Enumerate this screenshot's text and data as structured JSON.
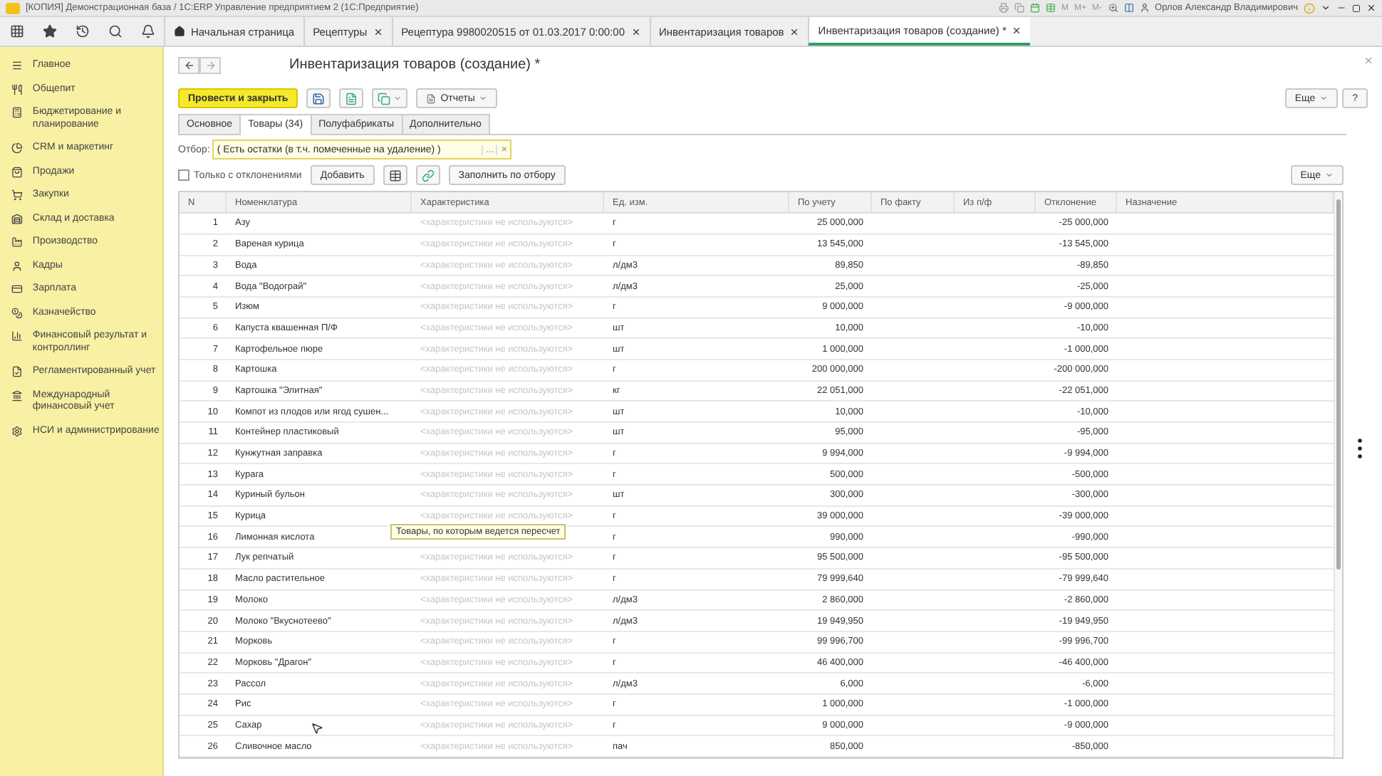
{
  "window": {
    "title": "[КОПИЯ] Демонстрационная база / 1С:ERP Управление предприятием 2  (1С:Предприятие)",
    "memory_buttons": [
      "M",
      "M+",
      "M-"
    ],
    "user": "Орлов Александр Владимирович"
  },
  "open_tabs": [
    {
      "label": "Начальная страница",
      "kind": "home",
      "selected": false
    },
    {
      "label": "Рецептуры",
      "kind": "closable",
      "selected": false
    },
    {
      "label": "Рецептура 9980020515 от 01.03.2017 0:00:00",
      "kind": "closable",
      "selected": false
    },
    {
      "label": "Инвентаризация товаров",
      "kind": "closable",
      "selected": false
    },
    {
      "label": "Инвентаризация товаров (создание) *",
      "kind": "closable",
      "selected": true
    }
  ],
  "sidebar": {
    "items": [
      {
        "label": "Главное"
      },
      {
        "label": "Общепит"
      },
      {
        "label": "Бюджетирование и планирование"
      },
      {
        "label": "CRM и маркетинг"
      },
      {
        "label": "Продажи"
      },
      {
        "label": "Закупки"
      },
      {
        "label": "Склад и доставка"
      },
      {
        "label": "Производство"
      },
      {
        "label": "Кадры"
      },
      {
        "label": "Зарплата"
      },
      {
        "label": "Казначейство"
      },
      {
        "label": "Финансовый результат и контроллинг"
      },
      {
        "label": "Регламентированный учет"
      },
      {
        "label": "Международный финансовый учет"
      },
      {
        "label": "НСИ и администрирование"
      }
    ]
  },
  "form": {
    "title": "Инвентаризация товаров (создание) *",
    "post_button": "Провести и закрыть",
    "reports_button": "Отчеты",
    "more_button": "Еще",
    "help_button": "?",
    "tabs": [
      {
        "label": "Основное",
        "selected": false
      },
      {
        "label": "Товары (34)",
        "selected": true
      },
      {
        "label": "Полуфабрикаты",
        "selected": false
      },
      {
        "label": "Дополнительно",
        "selected": false
      }
    ],
    "filter": {
      "label": "Отбор:",
      "value": "( Есть остатки (в т.ч. помеченные на удаление) )",
      "choose": "...",
      "clear": "×"
    },
    "only_deviations": {
      "label": "Только с отклонениями",
      "checked": false
    },
    "add_button": "Добавить",
    "fill_button": "Заполнить по отбору",
    "table_more_button": "Еще"
  },
  "table": {
    "columns": [
      "N",
      "Номенклатура",
      "Характеристика",
      "Ед. изм.",
      "По учету",
      "По факту",
      "Из п/ф",
      "Отклонение",
      "Назначение"
    ],
    "tooltip": "Товары, по которым ведется пересчет",
    "rows": [
      {
        "n": "1",
        "name": "Азу",
        "characteristic": "<характеристики не используются>",
        "unit": "г",
        "account": "25 000,000",
        "deviation": "-25 000,000"
      },
      {
        "n": "2",
        "name": "Вареная курица",
        "characteristic": "<характеристики не используются>",
        "unit": "г",
        "account": "13 545,000",
        "deviation": "-13 545,000"
      },
      {
        "n": "3",
        "name": "Вода",
        "characteristic": "<характеристики не используются>",
        "unit": "л/дм3",
        "account": "89,850",
        "deviation": "-89,850"
      },
      {
        "n": "4",
        "name": "Вода \"Водограй\"",
        "characteristic": "<характеристики не используются>",
        "unit": "л/дм3",
        "account": "25,000",
        "deviation": "-25,000"
      },
      {
        "n": "5",
        "name": "Изюм",
        "characteristic": "<характеристики не используются>",
        "unit": "г",
        "account": "9 000,000",
        "deviation": "-9 000,000"
      },
      {
        "n": "6",
        "name": "Капуста квашенная П/Ф",
        "characteristic": "<характеристики не используются>",
        "unit": "шт",
        "account": "10,000",
        "deviation": "-10,000"
      },
      {
        "n": "7",
        "name": "Картофельное пюре",
        "characteristic": "<характеристики не используются>",
        "unit": "шт",
        "account": "1 000,000",
        "deviation": "-1 000,000"
      },
      {
        "n": "8",
        "name": "Картошка",
        "characteristic": "<характеристики не используются>",
        "unit": "г",
        "account": "200 000,000",
        "deviation": "-200 000,000"
      },
      {
        "n": "9",
        "name": "Картошка \"Элитная\"",
        "characteristic": "<характеристики не используются>",
        "unit": "кг",
        "account": "22 051,000",
        "deviation": "-22 051,000"
      },
      {
        "n": "10",
        "name": "Компот из плодов или ягод сушен...",
        "characteristic": "<характеристики не используются>",
        "unit": "шт",
        "account": "10,000",
        "deviation": "-10,000"
      },
      {
        "n": "11",
        "name": "Контейнер пластиковый",
        "characteristic": "<характеристики не используются>",
        "unit": "шт",
        "account": "95,000",
        "deviation": "-95,000"
      },
      {
        "n": "12",
        "name": "Кунжутная заправка",
        "characteristic": "<характеристики не используются>",
        "unit": "г",
        "account": "9 994,000",
        "deviation": "-9 994,000"
      },
      {
        "n": "13",
        "name": "Курага",
        "characteristic": "<характеристики не используются>",
        "unit": "г",
        "account": "500,000",
        "deviation": "-500,000"
      },
      {
        "n": "14",
        "name": "Куриный бульон",
        "characteristic": "<характеристики не используются>",
        "unit": "шт",
        "account": "300,000",
        "deviation": "-300,000"
      },
      {
        "n": "15",
        "name": "Курица",
        "characteristic": "<характеристики не используются>",
        "unit": "г",
        "account": "39 000,000",
        "deviation": "-39 000,000"
      },
      {
        "n": "16",
        "name": "Лимонная кислота",
        "characteristic": "",
        "unit": "г",
        "account": "990,000",
        "deviation": "-990,000"
      },
      {
        "n": "17",
        "name": "Лук репчатый",
        "characteristic": "<характеристики не используются>",
        "unit": "г",
        "account": "95 500,000",
        "deviation": "-95 500,000"
      },
      {
        "n": "18",
        "name": "Масло растительное",
        "characteristic": "<характеристики не используются>",
        "unit": "г",
        "account": "79 999,640",
        "deviation": "-79 999,640"
      },
      {
        "n": "19",
        "name": "Молоко",
        "characteristic": "<характеристики не используются>",
        "unit": "л/дм3",
        "account": "2 860,000",
        "deviation": "-2 860,000"
      },
      {
        "n": "20",
        "name": "Молоко \"Вкуснотеево\"",
        "characteristic": "<характеристики не используются>",
        "unit": "л/дм3",
        "account": "19 949,950",
        "deviation": "-19 949,950"
      },
      {
        "n": "21",
        "name": "Морковь",
        "characteristic": "<характеристики не используются>",
        "unit": "г",
        "account": "99 996,700",
        "deviation": "-99 996,700"
      },
      {
        "n": "22",
        "name": "Морковь \"Драгон\"",
        "characteristic": "<характеристики не используются>",
        "unit": "г",
        "account": "46 400,000",
        "deviation": "-46 400,000"
      },
      {
        "n": "23",
        "name": "Рассол",
        "characteristic": "<характеристики не используются>",
        "unit": "л/дм3",
        "account": "6,000",
        "deviation": "-6,000"
      },
      {
        "n": "24",
        "name": "Рис",
        "characteristic": "<характеристики не используются>",
        "unit": "г",
        "account": "1 000,000",
        "deviation": "-1 000,000"
      },
      {
        "n": "25",
        "name": "Сахар",
        "characteristic": "<характеристики не используются>",
        "unit": "г",
        "account": "9 000,000",
        "deviation": "-9 000,000"
      },
      {
        "n": "26",
        "name": "Сливочное масло",
        "characteristic": "<характеристики не используются>",
        "unit": "пач",
        "account": "850,000",
        "deviation": "-850,000"
      }
    ]
  }
}
